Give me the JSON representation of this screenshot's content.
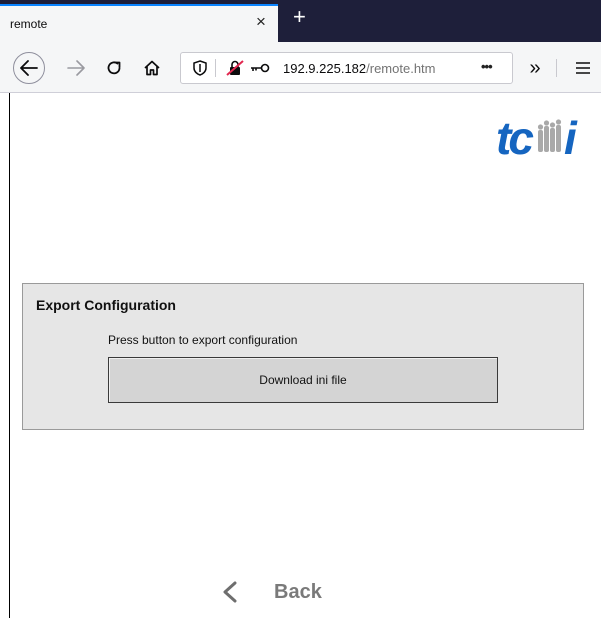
{
  "browser": {
    "tab_title": "remote",
    "tab_close": "×",
    "new_tab": "+",
    "url_host": "192.9.225.182",
    "url_path": "/remote.htm",
    "url_more": "•••",
    "overflow": "»"
  },
  "page": {
    "logo_alt": "tcmi",
    "panel": {
      "title": "Export Configuration",
      "hint": "Press button to export configuration",
      "button": "Download ini file"
    },
    "back": "Back"
  },
  "colors": {
    "tab_accent": "#0a84ff",
    "tabbar_bg": "#1e1f3a",
    "logo_blue": "#1565c0",
    "panel_bg": "#e6e6e6",
    "button_bg": "#d4d4d4",
    "back_text": "#7a7a7a"
  }
}
